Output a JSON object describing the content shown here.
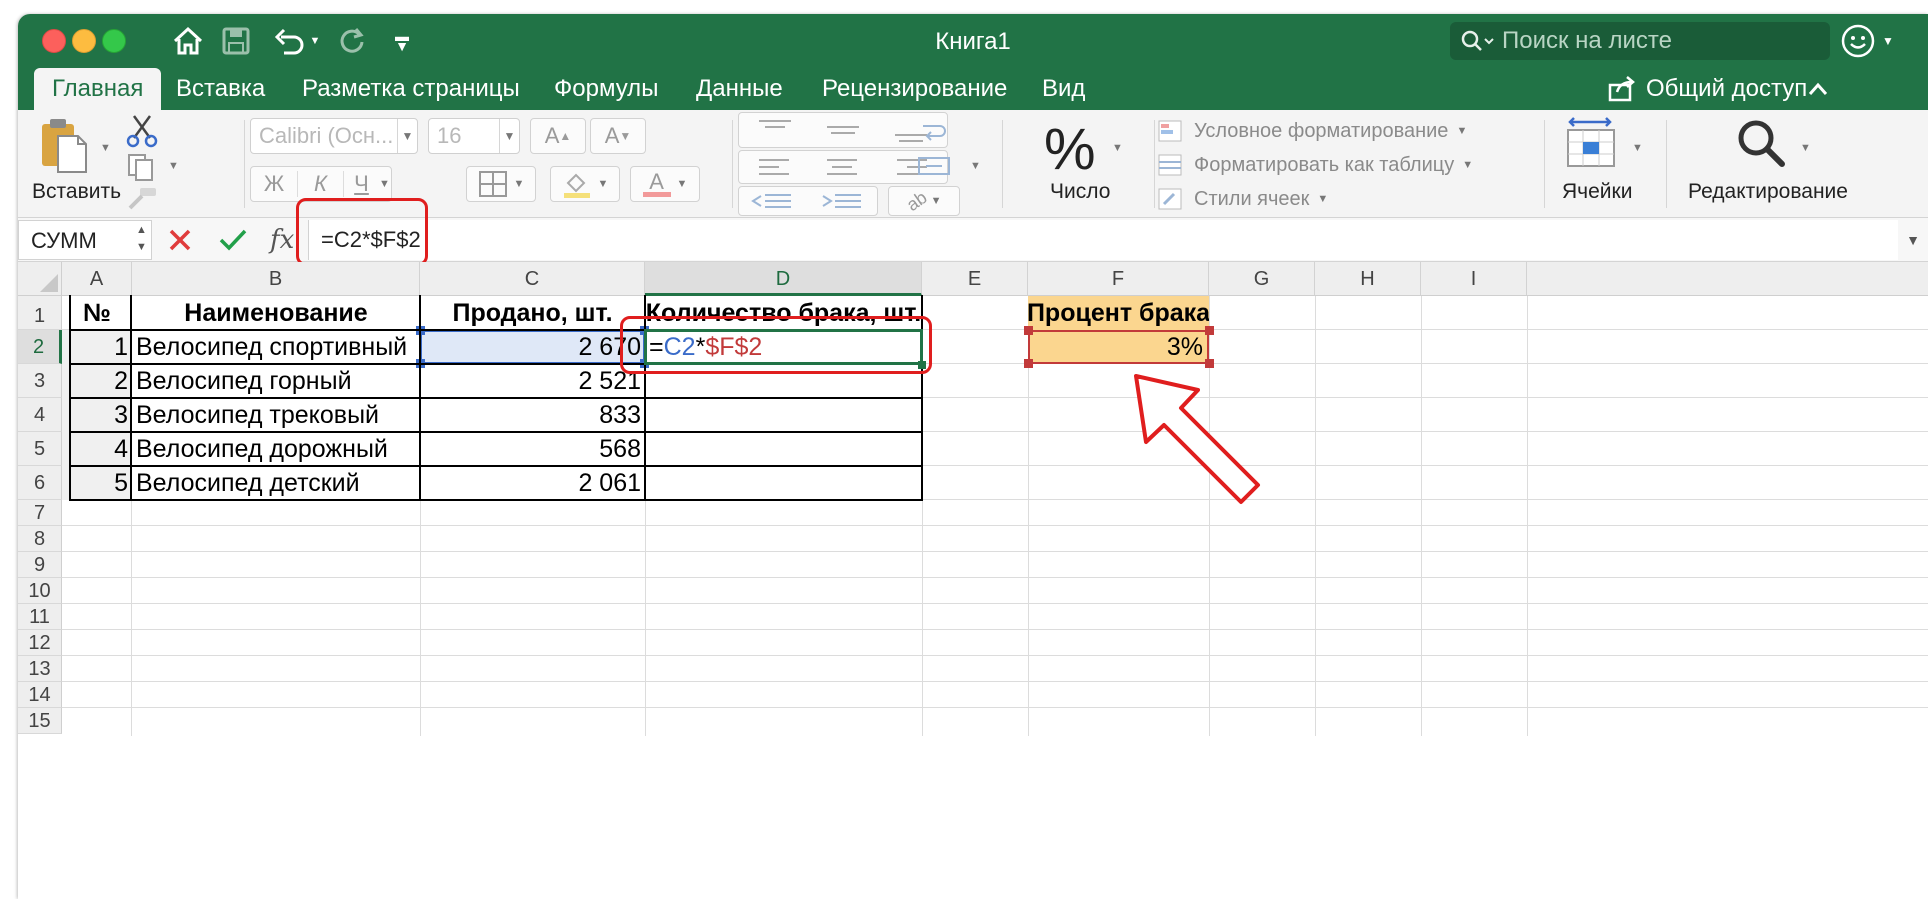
{
  "window": {
    "title": "Книга1",
    "search_placeholder": "Поиск на листе"
  },
  "quick_access": {
    "icons": [
      "home-icon",
      "save-icon",
      "undo-icon",
      "redo-icon",
      "customize-icon"
    ]
  },
  "tabs": [
    "Главная",
    "Вставка",
    "Разметка страницы",
    "Формулы",
    "Данные",
    "Рецензирование",
    "Вид"
  ],
  "share_label": "Общий доступ",
  "ribbon": {
    "paste_label": "Вставить",
    "font_name": "Calibri (Осн...",
    "font_size": "16",
    "bold": "Ж",
    "italic": "К",
    "underline": "Ч",
    "number_label": "Число",
    "number_symbol": "%",
    "styles": [
      "Условное форматирование",
      "Форматировать как таблицу",
      "Стили ячеек"
    ],
    "cells_label": "Ячейки",
    "editing_label": "Редактирование"
  },
  "formula_bar": {
    "name_box": "СУММ",
    "fx": "fx",
    "formula": "=C2*$F$2"
  },
  "grid": {
    "columns": [
      "A",
      "B",
      "C",
      "D",
      "E",
      "F",
      "G",
      "H",
      "I"
    ],
    "selected_column": "D",
    "rows": [
      "1",
      "2",
      "3",
      "4",
      "5",
      "6",
      "7",
      "8",
      "9",
      "10",
      "11",
      "12",
      "13",
      "14",
      "15"
    ],
    "selected_row": "2",
    "header": {
      "no": "№",
      "name": "Наименование",
      "sold": "Продано, шт.",
      "defect": "Количество брака, шт."
    },
    "data": [
      {
        "no": "1",
        "name": "Велосипед спортивный",
        "sold": "2 670"
      },
      {
        "no": "2",
        "name": "Велосипед горный",
        "sold": "2 521"
      },
      {
        "no": "3",
        "name": "Велосипед трековый",
        "sold": "833"
      },
      {
        "no": "4",
        "name": "Велосипед дорожный",
        "sold": "568"
      },
      {
        "no": "5",
        "name": "Велосипед детский",
        "sold": "2 061"
      }
    ],
    "edit_formula": {
      "eq": "=",
      "ref1": "C2",
      "op": "*",
      "ref2": "$F$2"
    },
    "percent_header": "Процент брака",
    "percent_value": "3%"
  },
  "colors": {
    "excel_green": "#217346",
    "annotation_red": "#e01e1e",
    "highlight_orange": "#fbd68f",
    "ref_blue": "#3a6bc9",
    "ref_red": "#c23a3a"
  }
}
